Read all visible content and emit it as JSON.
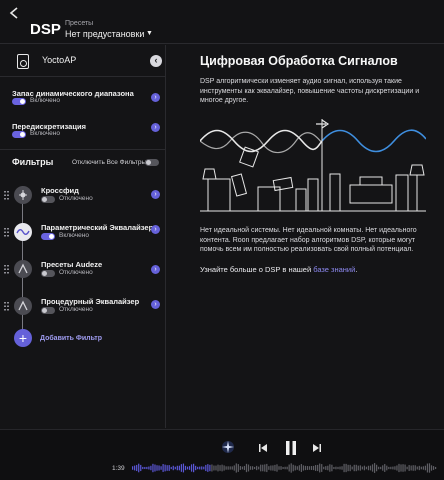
{
  "header": {
    "title": "DSP",
    "presets_label": "Пресеты",
    "presets_value": "Нет предустановки"
  },
  "device": {
    "name": "YoctoAP",
    "icon": "speaker-icon"
  },
  "settings": [
    {
      "title": "Запас динамического диапазона",
      "state": "Включено",
      "on": true
    },
    {
      "title": "Передискретизация",
      "state": "Включено",
      "on": true
    }
  ],
  "filters": {
    "heading": "Фильтры",
    "disable_all_label": "Отключить Все Фильтры",
    "disable_all_on": false,
    "items": [
      {
        "title": "Кроссфид",
        "state": "Отключено",
        "on": false,
        "icon": "crossfeed-icon"
      },
      {
        "title": "Параметрический Эквалайзер",
        "state": "Включено",
        "on": true,
        "icon": "equalizer-wave-icon"
      },
      {
        "title": "Пресеты Audeze",
        "state": "Отключено",
        "on": false,
        "icon": "audeze-icon"
      },
      {
        "title": "Процедурный Эквалайзер",
        "state": "Отключено",
        "on": false,
        "icon": "procedural-eq-icon"
      }
    ],
    "add_label": "Добавить Фильтр"
  },
  "info": {
    "title": "Цифровая Обработка Сигналов",
    "desc": "DSP алгоритмически изменяет аудио сигнал, используя такие инструменты как эквалайзер, повышение частоты дискретизации и многое другое.",
    "desc2": "Нет идеальной системы. Нет идеальной комнаты. Нет идеального контента. Roon предлагает набор алгоритмов DSP, которые могут помочь всем им полностью реализовать свой полный потенциал.",
    "kb_prefix": "Узнайте больше о DSP в нашей ",
    "kb_link": "базе знаний",
    "kb_suffix": "."
  },
  "player": {
    "elapsed": "1:39",
    "progress": 0.26,
    "accent": "#5b57d6"
  }
}
